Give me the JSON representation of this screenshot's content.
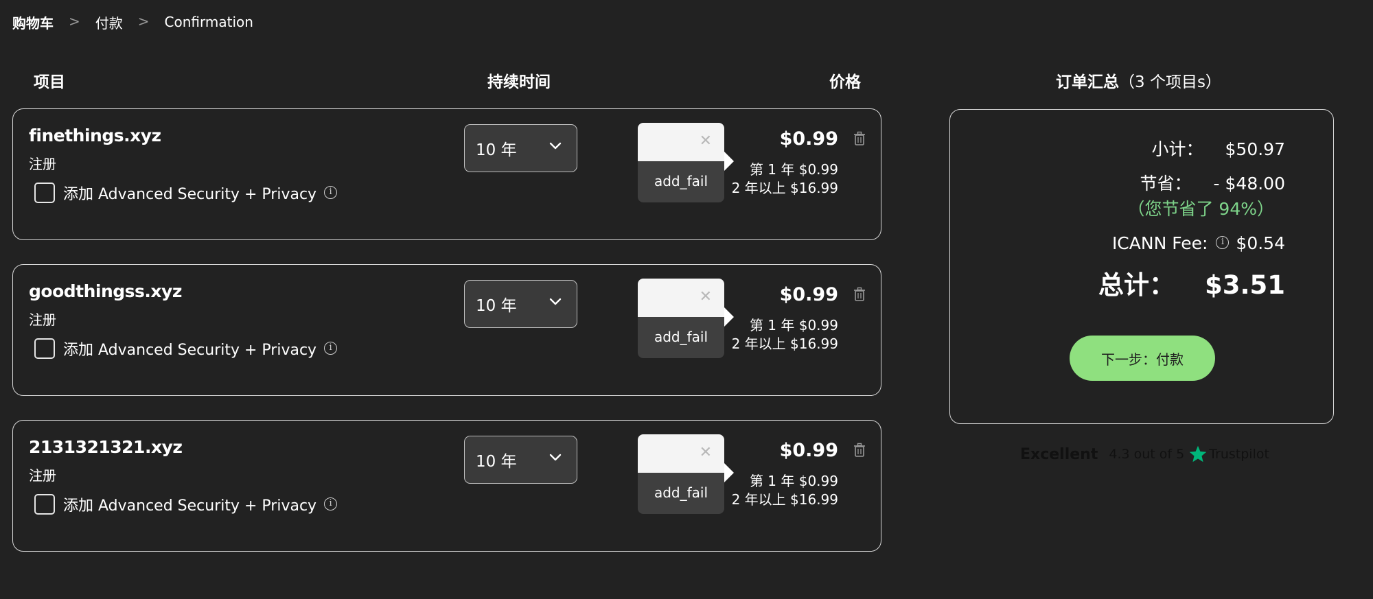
{
  "breadcrumb": {
    "items": [
      "购物车",
      "付款",
      "Confirmation"
    ],
    "separator": ">"
  },
  "columns": {
    "item": "项目",
    "duration": "持续时间",
    "price": "价格"
  },
  "cart_items": [
    {
      "domain": "finethings.xyz",
      "type": "注册",
      "addon_label": "添加 Advanced Security + Privacy",
      "duration": "10 年",
      "popup_text": "add_fail",
      "price": "$0.99",
      "first_year": "第 1 年 $0.99",
      "later_years": "2 年以上 $16.99"
    },
    {
      "domain": "goodthingss.xyz",
      "type": "注册",
      "addon_label": "添加 Advanced Security + Privacy",
      "duration": "10 年",
      "popup_text": "add_fail",
      "price": "$0.99",
      "first_year": "第 1 年 $0.99",
      "later_years": "2 年以上 $16.99"
    },
    {
      "domain": "2131321321.xyz",
      "type": "注册",
      "addon_label": "添加 Advanced Security + Privacy",
      "duration": "10 年",
      "popup_text": "add_fail",
      "price": "$0.99",
      "first_year": "第 1 年 $0.99",
      "later_years": "2 年以上 $16.99"
    }
  ],
  "summary": {
    "title": "订单汇总",
    "count": "（3 个项目s）",
    "subtotal_label": "小计：",
    "subtotal_value": "$50.97",
    "savings_label": "节省：",
    "savings_value": "- $48.00",
    "savings_percent": "（您节省了 94%）",
    "icann_label": "ICANN Fee:",
    "icann_value": "$0.54",
    "total_label": "总计：",
    "total_value": "$3.51",
    "next_button": "下一步：付款"
  },
  "trustpilot": {
    "rating_word": "Excellent",
    "score": "4.3 out of 5",
    "brand": "Trustpilot"
  },
  "colors": {
    "background": "#222222",
    "accent_button": "#8fe07f",
    "savings_text": "#7ed48a",
    "trustpilot_star": "#00b67a"
  },
  "icons": {
    "breadcrumb_separator": "chevron-right-icon",
    "dropdown": "chevron-down-icon",
    "info": "info-icon",
    "remove": "trash-icon",
    "close": "close-icon",
    "rating": "star-icon"
  }
}
